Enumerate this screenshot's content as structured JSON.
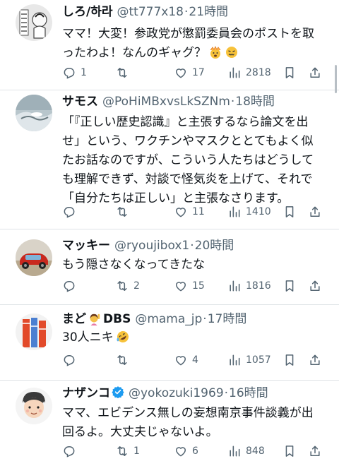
{
  "tweets": [
    {
      "name": "しろ/하라",
      "handle": "@tt777x18",
      "dot": "·",
      "time": "21時間",
      "lines": [
        "ママ！大変！参政党が懲罰委員会のポストを取",
        "ったわよ！なんのギャグ？"
      ],
      "reply": "1",
      "retweet": "",
      "like": "17",
      "views": "2818"
    },
    {
      "name": "サモス",
      "handle": "@PoHiMBxvsLkSZNm",
      "dot": "·",
      "time": "18時間",
      "lines": [
        "「『正しい歴史認識』と主張するなら論文を出",
        "せ」という、ワクチンやマスクととてもよく似",
        "たお話なのですが、こういう人たちはどうして",
        "も理解できず、対談で怪気炎を上げて、それで",
        "「自分たちは正しい」と主張なさります。"
      ],
      "reply": "",
      "retweet": "",
      "like": "11",
      "views": "1410"
    },
    {
      "name": "マッキー",
      "handle": "@ryoujibox1",
      "dot": "·",
      "time": "20時間",
      "lines": [
        "もう隠さなくなってきたな"
      ],
      "reply": "",
      "retweet": "2",
      "like": "15",
      "views": "1816"
    },
    {
      "name": "まど",
      "name_suffix": "DBS",
      "handle": "@mama_jp",
      "dot": "·",
      "time": "17時間",
      "lines": [
        "30人ニキ"
      ],
      "reply": "",
      "retweet": "",
      "like": "4",
      "views": "1057"
    },
    {
      "name": "ナザンコ",
      "handle": "@yokozuki1969",
      "dot": "·",
      "time": "16時間",
      "lines": [
        "ママ、エビデンス無しの妄想南京事件談義が出",
        "回るよ。大丈夫じゃないよ。"
      ],
      "reply": "",
      "retweet": "1",
      "like": "6",
      "views": "848"
    }
  ],
  "icons": {
    "reply": "reply-icon",
    "retweet": "retweet-icon",
    "like": "like-icon",
    "views": "views-icon",
    "bookmark": "bookmark-icon",
    "verified": "verified-badge-icon"
  },
  "colors": {
    "text": "#0f1419",
    "secondary": "#536471",
    "verified": "#1d9bf0",
    "divider": "#dfe3e6"
  }
}
